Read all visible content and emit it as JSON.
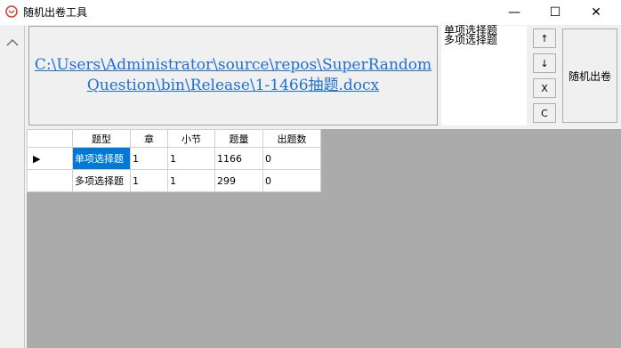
{
  "window": {
    "title": "随机出卷工具",
    "controls": {
      "minimize": "—",
      "maximize": "☐",
      "close": "✕"
    }
  },
  "file": {
    "path": "C:\\Users\\Administrator\\source\\repos\\SuperRandomQuestion\\bin\\Release\\1-1466抽题.docx"
  },
  "type_list": {
    "items": [
      "单项选择题",
      "多项选择题"
    ]
  },
  "buttons": {
    "up": "↑",
    "down": "↓",
    "x": "X",
    "c": "C",
    "random": "随机出卷"
  },
  "table": {
    "columns": [
      "题型",
      "章",
      "小节",
      "题量",
      "出题数"
    ],
    "rows": [
      {
        "cells": [
          "单项选择题",
          "1",
          "1",
          "1166",
          "0"
        ],
        "current": true,
        "selected_cell": 0
      },
      {
        "cells": [
          "多项选择题",
          "1",
          "1",
          "299",
          "0"
        ],
        "current": false
      }
    ],
    "row_indicator": "▶"
  },
  "colors": {
    "link": "#1e6fd9",
    "selection": "#0078d7",
    "grid_background": "#ababab",
    "panel_background": "#f0f0f0"
  }
}
